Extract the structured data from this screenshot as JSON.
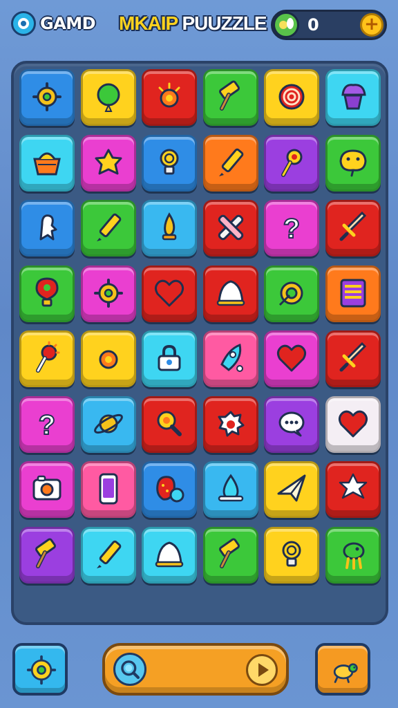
{
  "header": {
    "brand_name": "GAMD",
    "title_part1": "MKAIP",
    "title_part2": "PUUZZLE",
    "score_value": "0",
    "add_label": "+"
  },
  "colors": {
    "blue": "#2f8de6",
    "yellow": "#ffd21e",
    "red": "#e0241f",
    "green": "#3cc83a",
    "cyan": "#3ed6f2",
    "magenta": "#ea3fd0",
    "orange": "#ff7a1c",
    "purple": "#9b3fe0",
    "sky": "#39b8f0",
    "pink": "#ff5aa2",
    "white": "#f4eef4"
  },
  "board": {
    "rows": [
      [
        {
          "color": "blue",
          "icon": "gear-icon"
        },
        {
          "color": "yellow",
          "icon": "balloon-icon"
        },
        {
          "color": "red",
          "icon": "sun-icon"
        },
        {
          "color": "green",
          "icon": "hammer-icon"
        },
        {
          "color": "yellow",
          "icon": "spiral-icon"
        },
        {
          "color": "cyan",
          "icon": "muffin-icon"
        }
      ],
      [
        {
          "color": "cyan",
          "icon": "basket-icon"
        },
        {
          "color": "magenta",
          "icon": "star-blob-icon"
        },
        {
          "color": "blue",
          "icon": "lightbulb-icon"
        },
        {
          "color": "orange",
          "icon": "pencil-icon"
        },
        {
          "color": "purple",
          "icon": "bulb-key-icon"
        },
        {
          "color": "green",
          "icon": "bird-icon"
        }
      ],
      [
        {
          "color": "blue",
          "icon": "ghost-icon"
        },
        {
          "color": "green",
          "icon": "pencil-icon"
        },
        {
          "color": "sky",
          "icon": "flame-icon"
        },
        {
          "color": "red",
          "icon": "crossed-tools-icon"
        },
        {
          "color": "magenta",
          "icon": "question-mark-icon"
        },
        {
          "color": "red",
          "icon": "sword-icon"
        }
      ],
      [
        {
          "color": "green",
          "icon": "pin-bulb-icon"
        },
        {
          "color": "magenta",
          "icon": "gear-icon"
        },
        {
          "color": "red",
          "icon": "heart-icon"
        },
        {
          "color": "red",
          "icon": "bell-icon"
        },
        {
          "color": "green",
          "icon": "target-icon"
        },
        {
          "color": "orange",
          "icon": "book-icon"
        }
      ],
      [
        {
          "color": "yellow",
          "icon": "torch-icon"
        },
        {
          "color": "yellow",
          "icon": "sun-icon"
        },
        {
          "color": "cyan",
          "icon": "lock-icon"
        },
        {
          "color": "pink",
          "icon": "rocket-icon"
        },
        {
          "color": "magenta",
          "icon": "heart-icon"
        },
        {
          "color": "red",
          "icon": "sword-icon"
        }
      ],
      [
        {
          "color": "magenta",
          "icon": "question-mark-icon"
        },
        {
          "color": "sky",
          "icon": "planet-icon"
        },
        {
          "color": "red",
          "icon": "magnifier-icon"
        },
        {
          "color": "red",
          "icon": "splat-icon"
        },
        {
          "color": "purple",
          "icon": "chat-bubble-icon"
        },
        {
          "color": "white",
          "icon": "heart-icon"
        }
      ],
      [
        {
          "color": "magenta",
          "icon": "camera-icon"
        },
        {
          "color": "pink",
          "icon": "phone-icon"
        },
        {
          "color": "blue",
          "icon": "strawberry-icon"
        },
        {
          "color": "sky",
          "icon": "drop-icon"
        },
        {
          "color": "yellow",
          "icon": "paper-plane-icon"
        },
        {
          "color": "red",
          "icon": "star-icon"
        }
      ],
      [
        {
          "color": "purple",
          "icon": "hammer-icon"
        },
        {
          "color": "cyan",
          "icon": "pencil-icon"
        },
        {
          "color": "cyan",
          "icon": "bell-icon"
        },
        {
          "color": "green",
          "icon": "hammer-icon"
        },
        {
          "color": "yellow",
          "icon": "lightbulb-icon"
        },
        {
          "color": "green",
          "icon": "dino-icon"
        }
      ]
    ]
  },
  "bottom": {
    "left_icon": "gear-icon",
    "right_icon": "turtle-icon",
    "search_icon": "search-icon",
    "play_icon": "play-icon"
  }
}
